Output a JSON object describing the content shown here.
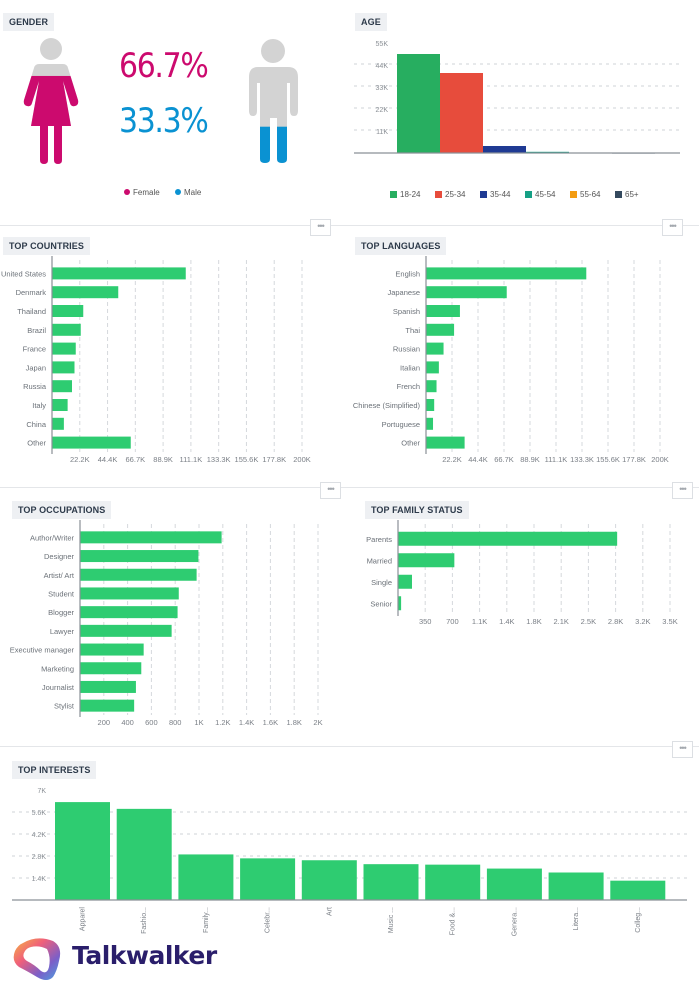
{
  "gender": {
    "title": "GENDER",
    "female_pct": "66.7%",
    "male_pct": "33.3%",
    "female_fraction": 0.667,
    "male_fraction": 0.333,
    "colors": {
      "female": "#cc0a6e",
      "male": "#0a92d2",
      "figure": "#d3d3d3"
    },
    "legend": [
      {
        "label": "Female",
        "color": "#cc0a6e"
      },
      {
        "label": "Male",
        "color": "#0a92d2"
      }
    ]
  },
  "more_button_label": "•••",
  "brand": {
    "name": "Talkwalker"
  },
  "chart_data": [
    {
      "id": "age",
      "type": "bar",
      "title": "AGE",
      "categories": [
        "18-24",
        "25-34",
        "35-44",
        "45-54",
        "55-64",
        "65+"
      ],
      "values": [
        49500,
        40000,
        3500,
        600,
        200,
        0
      ],
      "colors": [
        "#27ae60",
        "#e74c3c",
        "#1f3a93",
        "#16a085",
        "#f39c12",
        "#34495e"
      ],
      "ylim": [
        0,
        55000
      ],
      "yticks": [
        11000,
        22000,
        33000,
        44000,
        55000
      ],
      "ytick_labels": [
        "11K",
        "22K",
        "33K",
        "44K",
        "55K"
      ],
      "grid": true,
      "legend": "bottom"
    },
    {
      "id": "countries",
      "type": "bar",
      "orientation": "horizontal",
      "title": "TOP COUNTRIES",
      "categories": [
        "United States",
        "Denmark",
        "Thailand",
        "Brazil",
        "France",
        "Japan",
        "Russia",
        "Italy",
        "China",
        "Other"
      ],
      "values": [
        107000,
        53000,
        25000,
        23000,
        19000,
        18000,
        16000,
        12500,
        9500,
        63000
      ],
      "xlim": [
        0,
        200000
      ],
      "xtick_labels": [
        "22.2K",
        "44.4K",
        "66.7K",
        "88.9K",
        "111.1K",
        "133.3K",
        "155.6K",
        "177.8K",
        "200K"
      ],
      "color": "#2ecc71",
      "grid": true
    },
    {
      "id": "languages",
      "type": "bar",
      "orientation": "horizontal",
      "title": "TOP LANGUAGES",
      "categories": [
        "English",
        "Japanese",
        "Spanish",
        "Thai",
        "Russian",
        "Italian",
        "French",
        "Chinese (Simplified)",
        "Portuguese",
        "Other"
      ],
      "values": [
        137000,
        69000,
        29000,
        24000,
        15000,
        11000,
        9000,
        7000,
        6000,
        33000
      ],
      "xlim": [
        0,
        200000
      ],
      "xtick_labels": [
        "22.2K",
        "44.4K",
        "66.7K",
        "88.9K",
        "111.1K",
        "133.3K",
        "155.6K",
        "177.8K",
        "200K"
      ],
      "color": "#2ecc71",
      "grid": true
    },
    {
      "id": "occupations",
      "type": "bar",
      "orientation": "horizontal",
      "title": "TOP OCCUPATIONS",
      "categories": [
        "Author/Writer",
        "Designer",
        "Artist/ Art",
        "Student",
        "Blogger",
        "Lawyer",
        "Executive manager",
        "Marketing",
        "Journalist",
        "Stylist"
      ],
      "values": [
        1190,
        995,
        980,
        830,
        820,
        770,
        535,
        515,
        470,
        455
      ],
      "xlim": [
        0,
        2000
      ],
      "xtick_labels": [
        "200",
        "400",
        "600",
        "800",
        "1K",
        "1.2K",
        "1.4K",
        "1.6K",
        "1.8K",
        "2K"
      ],
      "color": "#2ecc71",
      "grid": true
    },
    {
      "id": "family",
      "type": "bar",
      "orientation": "horizontal",
      "title": "TOP FAMILY STATUS",
      "categories": [
        "Parents",
        "Married",
        "Single",
        "Senior"
      ],
      "values": [
        2820,
        725,
        180,
        40
      ],
      "xlim": [
        0,
        3500
      ],
      "xtick_labels": [
        "350",
        "700",
        "1.1K",
        "1.4K",
        "1.8K",
        "2.1K",
        "2.5K",
        "2.8K",
        "3.2K",
        "3.5K"
      ],
      "color": "#2ecc71",
      "grid": true
    },
    {
      "id": "interests",
      "type": "bar",
      "title": "TOP INTERESTS",
      "categories": [
        "Apparel",
        "Fashio...",
        "Family...",
        "Celebr...",
        "Art",
        "Music ...",
        "Food &...",
        "Genera...",
        "Litera...",
        "Colleg..."
      ],
      "values": [
        6230,
        5800,
        2900,
        2650,
        2530,
        2280,
        2250,
        2000,
        1750,
        1230
      ],
      "ylim": [
        0,
        7000
      ],
      "yticks": [
        1400,
        2800,
        4200,
        5600,
        7000
      ],
      "ytick_labels": [
        "1.4K",
        "2.8K",
        "4.2K",
        "5.6K",
        "7K"
      ],
      "color": "#2ecc71",
      "grid": true
    }
  ]
}
